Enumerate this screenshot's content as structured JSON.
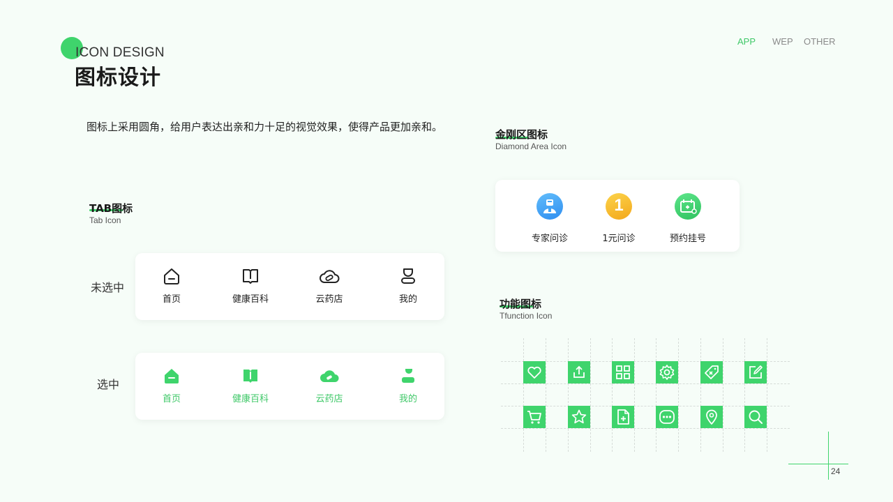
{
  "header": {
    "title_en": "ICON DESIGN",
    "title_cn": "图标设计",
    "nav": [
      {
        "label": "APP",
        "active": true
      },
      {
        "label": "WEP",
        "active": false
      },
      {
        "label": "OTHER",
        "active": false
      }
    ]
  },
  "intro": "图标上采用圆角，给用户表达出亲和力十足的视觉效果，使得产品更加亲和。",
  "tab_section": {
    "title": "TAB图标",
    "subtitle": "Tab Icon",
    "unselected_label": "未选中",
    "selected_label": "选中",
    "items": [
      {
        "label": "首页",
        "icon": "home-icon"
      },
      {
        "label": "健康百科",
        "icon": "book-icon"
      },
      {
        "label": "云药店",
        "icon": "cloud-pill-icon"
      },
      {
        "label": "我的",
        "icon": "user-icon"
      }
    ]
  },
  "diamond_section": {
    "title": "金刚区图标",
    "subtitle": "Diamond Area Icon",
    "items": [
      {
        "label": "专家问诊",
        "icon": "doctor-icon",
        "color": "#3ea3f5"
      },
      {
        "label": "1元问诊",
        "icon": "one-yuan-icon",
        "color": "#f8b825",
        "glyph": "1"
      },
      {
        "label": "预约挂号",
        "icon": "appointment-icon",
        "color": "#3fd46c"
      }
    ]
  },
  "function_section": {
    "title": "功能图标",
    "subtitle": "Tfunction Icon",
    "icons": [
      "heart-icon",
      "share-icon",
      "grid-icon",
      "gear-icon",
      "tag-icon",
      "edit-icon",
      "cart-icon",
      "star-icon",
      "add-file-icon",
      "message-icon",
      "location-icon",
      "search-icon"
    ]
  },
  "colors": {
    "accent": "#3fd46c",
    "background": "#f6fdf8"
  },
  "page_number": "24"
}
